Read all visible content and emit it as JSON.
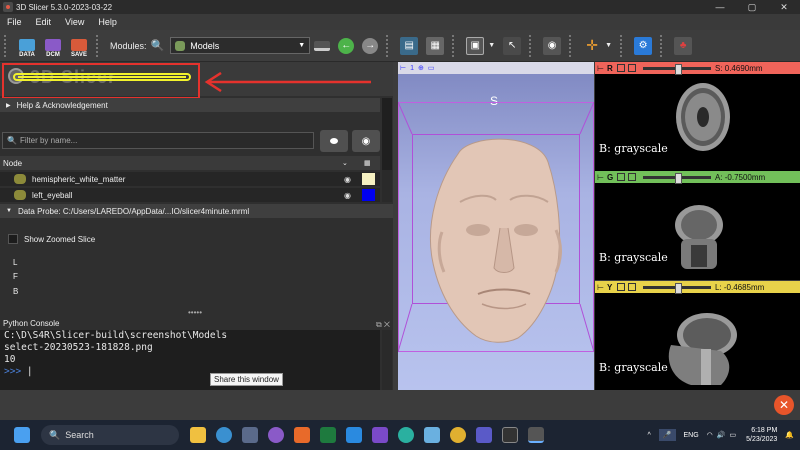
{
  "window": {
    "title": "3D Slicer 5.3.0-2023-03-22",
    "controls": [
      "—",
      "▢",
      "✕"
    ]
  },
  "menu": {
    "items": [
      "File",
      "Edit",
      "View",
      "Help"
    ]
  },
  "toolbar": {
    "data_label": "DATA",
    "dcm_label": "DCM",
    "save_label": "SAVE",
    "modules_label": "Modules:",
    "module_selected": "Models"
  },
  "left": {
    "logo_text": "3D Slicer",
    "help_label": "Help & Acknowledgement",
    "filter_placeholder": "Filter by name...",
    "node_header": "Node",
    "nodes": [
      {
        "name": "hemispheric_white_matter",
        "color": "#f6f1c2"
      },
      {
        "name": "left_eyeball",
        "color": "#0000f0"
      }
    ],
    "probe_label": "Data Probe: C:/Users/LAREDO/AppData/...IO/slicer4minute.mrml",
    "show_zoomed": "Show Zoomed Slice",
    "lfb": [
      "L",
      "F",
      "B"
    ],
    "python_console": "Python Console",
    "console_lines": [
      "C:\\D\\S4R\\Slicer-build\\screenshot\\Models",
      "select-20230523-181828.png",
      "10"
    ],
    "prompt": ">>>",
    "tooltip": "Share this window"
  },
  "view3d": {
    "orientation": "S",
    "bar_num": "1"
  },
  "slices": [
    {
      "letter": "R",
      "value": "S: 0.4690mm",
      "color": "#f0645a",
      "label": "B: grayscale"
    },
    {
      "letter": "G",
      "value": "A: -0.7500mm",
      "color": "#72c05a",
      "label": "B: grayscale"
    },
    {
      "letter": "Y",
      "value": "L: -0.4685mm",
      "color": "#e8d24a",
      "label": "B: grayscale"
    }
  ],
  "taskbar": {
    "search": "Search",
    "lang": "ENG",
    "time": "6:18 PM",
    "date": "5/23/2023"
  }
}
